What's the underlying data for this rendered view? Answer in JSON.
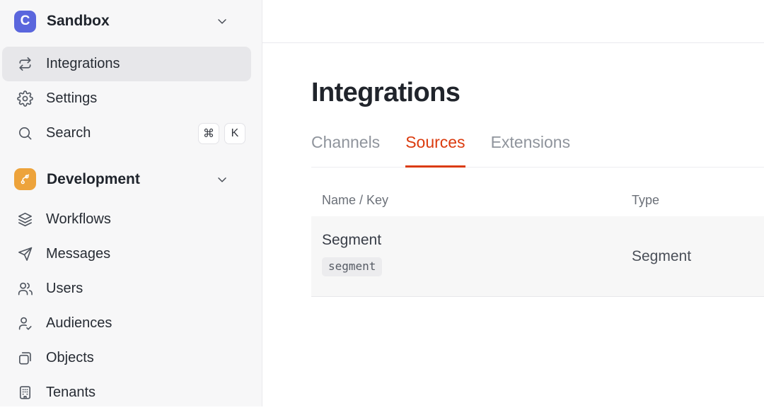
{
  "sidebar": {
    "workspace": {
      "name": "Sandbox",
      "logo_letter": "C"
    },
    "top_items": [
      {
        "label": "Integrations",
        "icon": "swap-arrows-icon",
        "active": true
      },
      {
        "label": "Settings",
        "icon": "gear-icon",
        "active": false
      },
      {
        "label": "Search",
        "icon": "search-icon",
        "active": false
      }
    ],
    "search_shortcut": {
      "meta": "⌘",
      "key": "K"
    },
    "section": {
      "name": "Development",
      "icon": "branch-icon"
    },
    "section_items": [
      {
        "label": "Workflows",
        "icon": "layers-icon"
      },
      {
        "label": "Messages",
        "icon": "paper-plane-icon"
      },
      {
        "label": "Users",
        "icon": "users-icon"
      },
      {
        "label": "Audiences",
        "icon": "user-check-icon"
      },
      {
        "label": "Objects",
        "icon": "copy-pages-icon"
      },
      {
        "label": "Tenants",
        "icon": "building-icon"
      }
    ]
  },
  "main": {
    "title": "Integrations",
    "tabs": [
      {
        "label": "Channels",
        "active": false
      },
      {
        "label": "Sources",
        "active": true
      },
      {
        "label": "Extensions",
        "active": false
      }
    ],
    "table": {
      "columns": [
        "Name / Key",
        "Type"
      ],
      "rows": [
        {
          "name": "Segment",
          "key": "segment",
          "type": "Segment"
        }
      ]
    }
  },
  "colors": {
    "accent": "#DB3B0E",
    "workspace_logo": "#5A66DD",
    "development_icon": "#EDA33B",
    "sidebar_bg": "#F7F7F8",
    "active_item_bg": "#E7E7EA",
    "row_bg": "#F7F7F7"
  }
}
